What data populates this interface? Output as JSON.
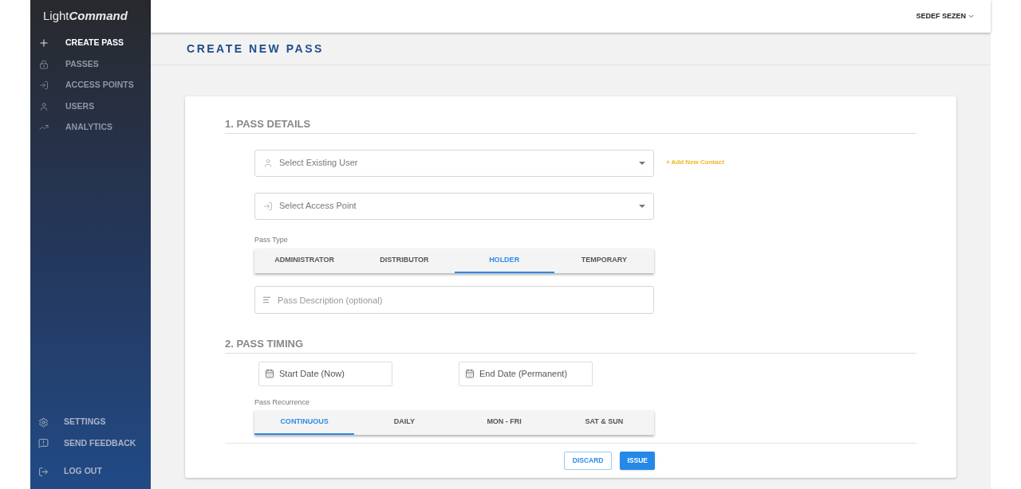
{
  "logo": "Light**Command**",
  "sidebar": {
    "items": [
      {
        "label": "CREATE PASS",
        "selected": true
      },
      {
        "label": "PASSES",
        "selected": false
      },
      {
        "label": "ACCESS POINTS",
        "selected": false
      },
      {
        "label": "USERS",
        "selected": false
      },
      {
        "label": "ANALYTICS",
        "selected": false
      }
    ],
    "footer_items": [
      {
        "label": "SETTINGS"
      },
      {
        "label": "SEND FEEDBACK"
      },
      {
        "label": "LOG OUT"
      }
    ]
  },
  "user_menu": "SEDEF SEZEN",
  "page_title": "CREATE NEW PASS",
  "details": {
    "heading": "1. PASS DETAILS",
    "user_select": {
      "placeholder": "Select Existing User"
    },
    "add_contact": "+ Add New Contact",
    "access_select": {
      "placeholder": "Select Access Point"
    },
    "pass_type_label": "Pass Type",
    "pass_types": [
      {
        "label": "ADMINISTRATOR",
        "selected": false
      },
      {
        "label": "DISTRIBUTOR",
        "selected": false
      },
      {
        "label": "HOLDER",
        "selected": true
      },
      {
        "label": "TEMPORARY",
        "selected": false
      }
    ],
    "description": {
      "placeholder": "Pass Description (optional)"
    }
  },
  "timing": {
    "heading": "2. PASS TIMING",
    "start_date": {
      "placeholder": "Start Date (Now)"
    },
    "end_date": {
      "placeholder": "End Date (Permanent)"
    },
    "recurrence_label": "Pass Recurrence",
    "recurrences": [
      {
        "label": "CONTINUOUS",
        "selected": true
      },
      {
        "label": "DAILY",
        "selected": false
      },
      {
        "label": "MON - FRI",
        "selected": false
      },
      {
        "label": "SAT & SUN",
        "selected": false
      }
    ]
  },
  "buttons": {
    "discard": "DISCARD",
    "issue": "ISSUE"
  }
}
